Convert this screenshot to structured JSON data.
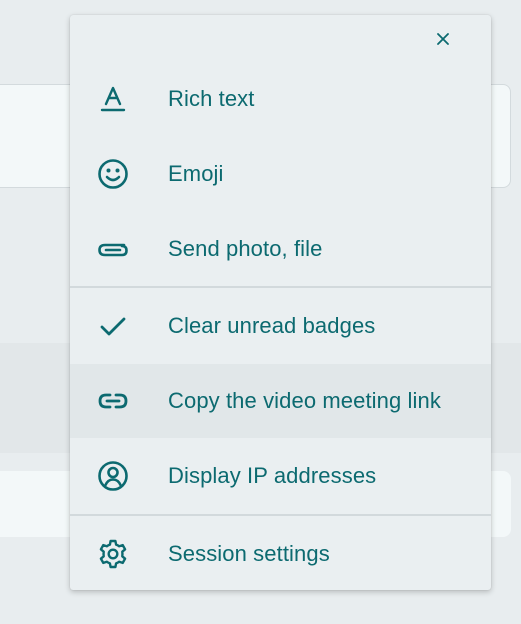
{
  "colors": {
    "accent": "#0c6a70",
    "menu_background": "#eaeff1",
    "hover_background": "#e1e7e9",
    "page_background": "#e8edef"
  },
  "menu": {
    "close_icon": "close-icon",
    "sections": [
      {
        "items": [
          {
            "label": "Rich text",
            "icon": "text-format-icon"
          },
          {
            "label": "Emoji",
            "icon": "smiley-icon"
          },
          {
            "label": "Send photo, file",
            "icon": "paperclip-icon"
          }
        ]
      },
      {
        "items": [
          {
            "label": "Clear unread badges",
            "icon": "checkmark-icon"
          },
          {
            "label": "Copy the video meeting link",
            "icon": "link-icon",
            "highlighted": true
          },
          {
            "label": "Display IP addresses",
            "icon": "user-circle-icon"
          }
        ]
      },
      {
        "items": [
          {
            "label": "Session settings",
            "icon": "gear-icon"
          }
        ]
      }
    ]
  }
}
